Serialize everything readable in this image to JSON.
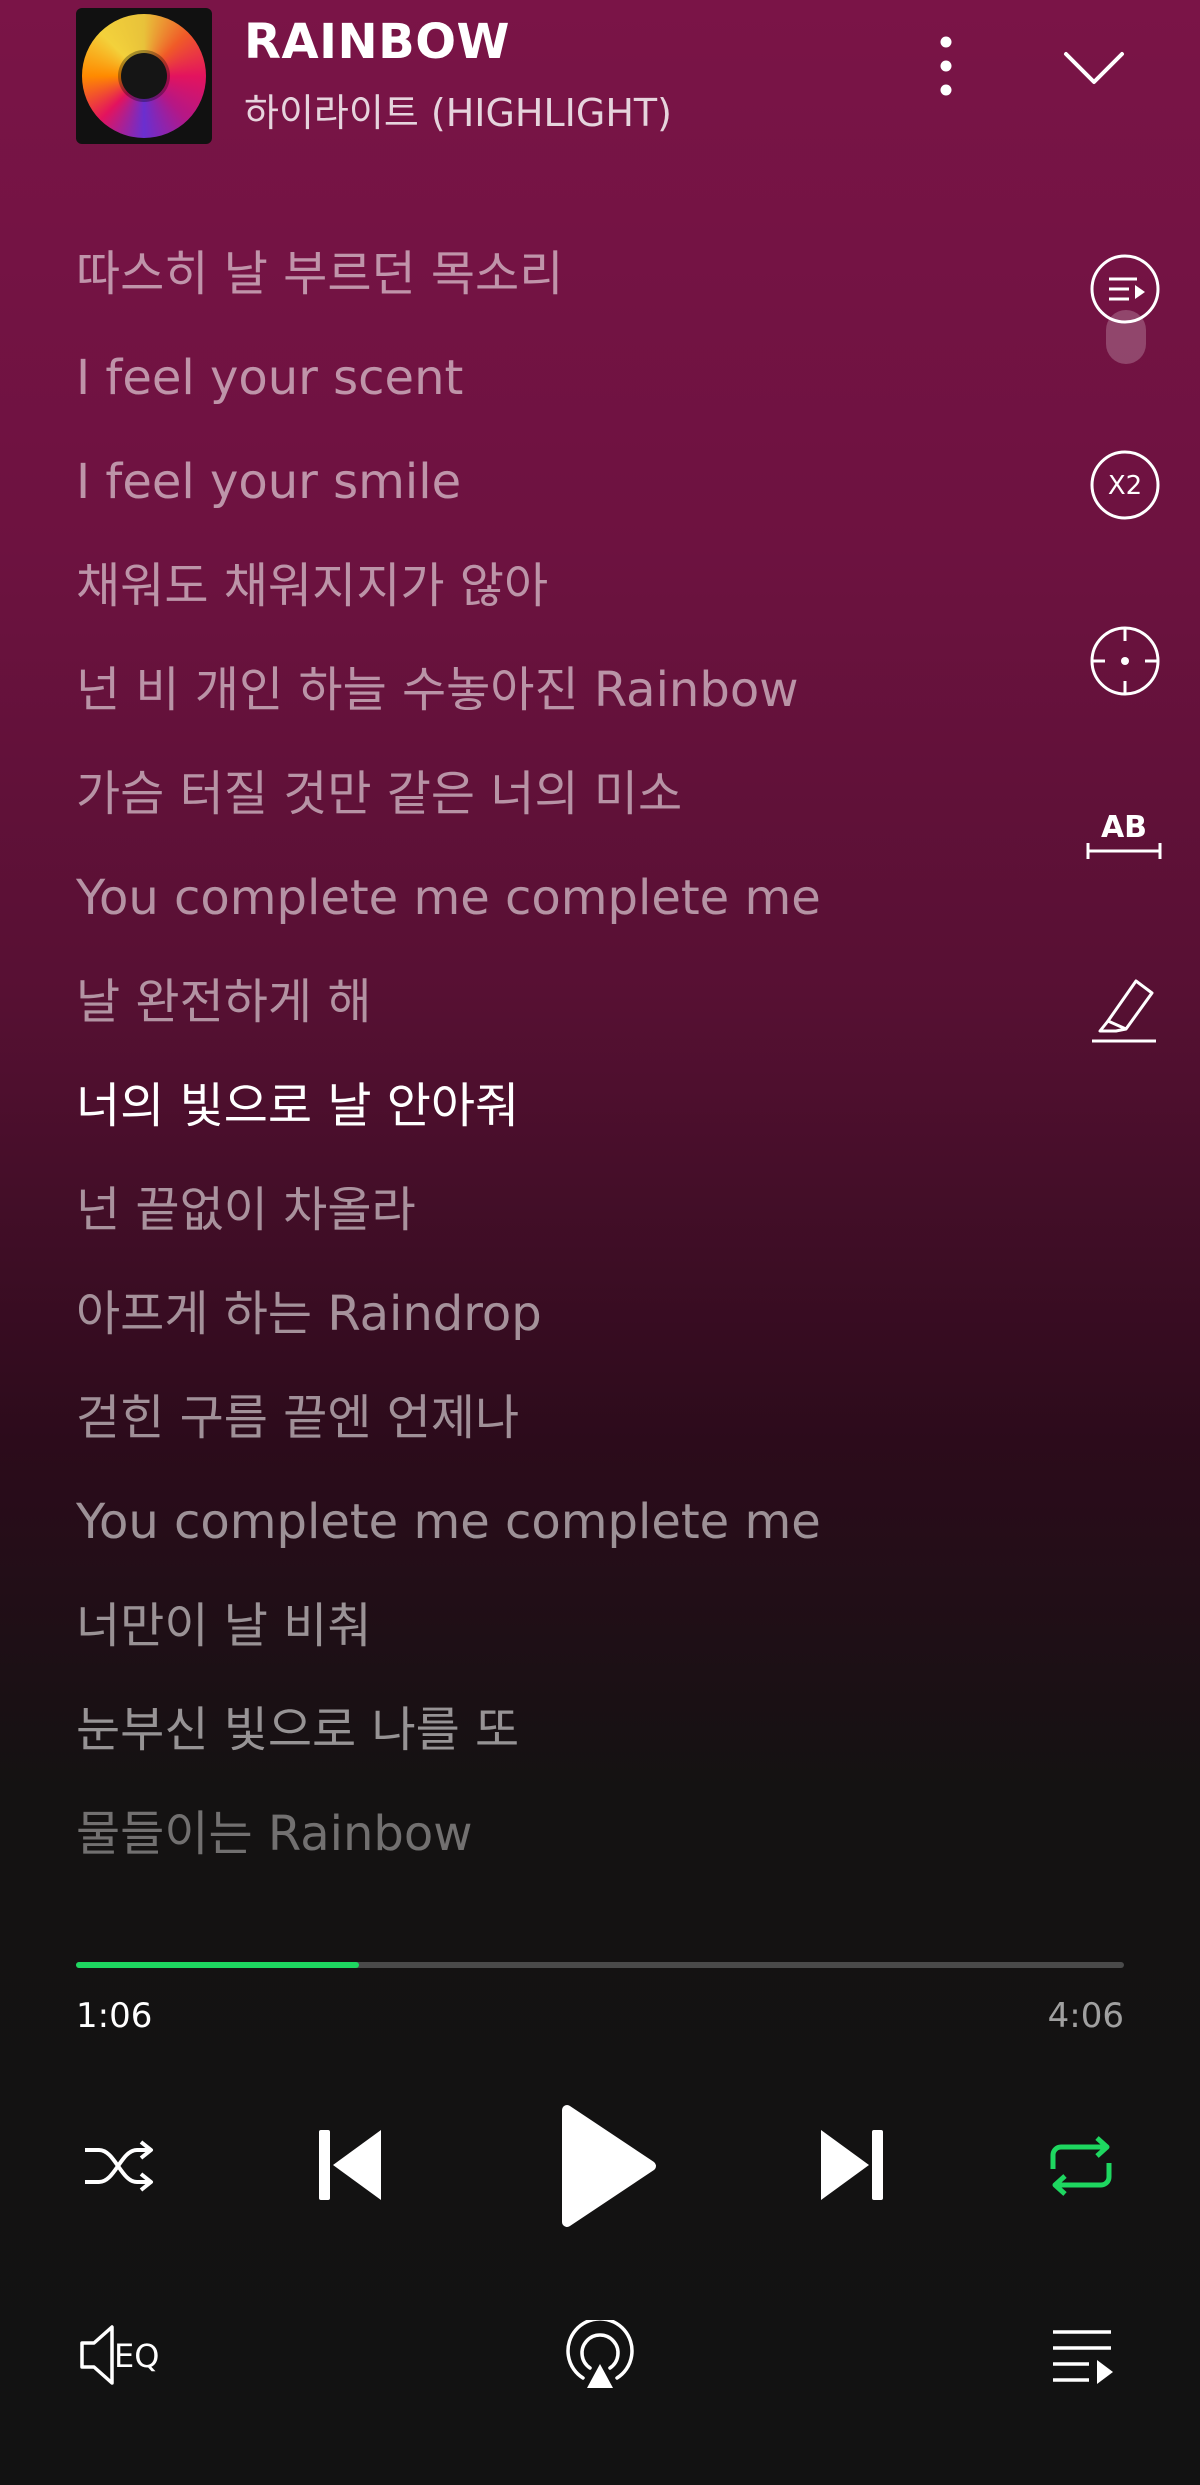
{
  "player": {
    "title": "RAINBOW",
    "artist": "하이라이트 (HIGHLIGHT)",
    "accent_color": "#1ed760",
    "icons": {
      "more": "more-vertical-icon",
      "collapse": "chevron-down-icon",
      "lyrics_list": "lyrics-list-icon",
      "speed": "speed-x2-icon",
      "focus": "crosshair-icon",
      "ab_repeat": "ab-repeat-icon",
      "highlight": "highlighter-icon",
      "shuffle": "shuffle-icon",
      "previous": "skip-previous-icon",
      "play": "play-icon",
      "next": "skip-next-icon",
      "repeat": "repeat-icon",
      "eq": "equalizer-icon",
      "cast": "airplay-icon",
      "queue": "queue-icon"
    },
    "speed_label": "X2",
    "ab_label": "AB",
    "eq_label": "EQ"
  },
  "lyrics": [
    "따스히 날 부르던 목소리",
    "I feel your scent",
    "I feel your smile",
    "채워도 채워지지가 않아",
    "넌 비 개인 하늘 수놓아진 Rainbow",
    "가슴 터질 것만 같은 너의 미소",
    "You complete me complete me",
    "날 완전하게 해",
    "너의 빛으로 날 안아줘",
    "넌 끝없이 차올라",
    "아프게 하는 Raindrop",
    "걷힌 구름 끝엔 언제나",
    "You complete me complete me",
    "너만이 날 비춰",
    "눈부신 빛으로 나를 또",
    "물들이는 Rainbow"
  ],
  "active_lyric_index": 8,
  "progress": {
    "current": "1:06",
    "total": "4:06",
    "fraction": 0.27
  }
}
